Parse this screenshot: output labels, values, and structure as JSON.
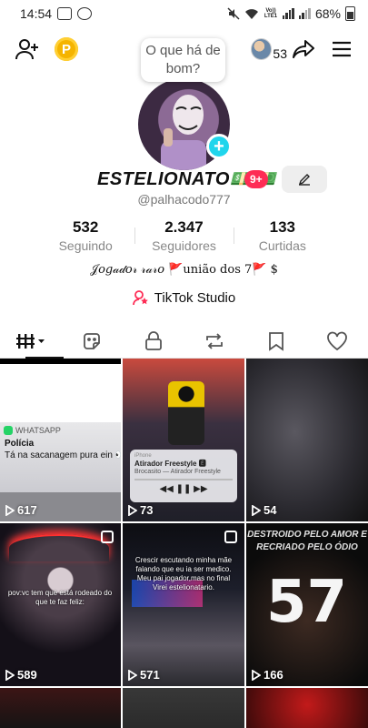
{
  "status_bar": {
    "time": "14:54",
    "volte": "Vo)) LTE1",
    "battery_text": "68%"
  },
  "top_nav": {
    "coin_letter": "P",
    "visitors_count": "53"
  },
  "profile": {
    "bubble_text": "O que há de bom?",
    "display_name": "ESTELIONATO💵💵",
    "badge_count": "9+",
    "username": "@palhacodo777",
    "stats": [
      {
        "value": "532",
        "label": "Seguindo"
      },
      {
        "value": "2.347",
        "label": "Seguidores"
      },
      {
        "value": "133",
        "label": "Curtidas"
      }
    ],
    "bio": "𝒥𝑜𝑔𝒶𝒹𝑜𝓇 𝓇𝒶𝓇𝑜 🚩união dos 7🚩 $",
    "studio_label": "TikTok Studio"
  },
  "tabs": [
    "videos-grid",
    "reposts",
    "private",
    "favorites-repost",
    "saved",
    "liked"
  ],
  "videos": [
    {
      "views": "617",
      "wa_app": "WHATSAPP",
      "wa_title": "Polícia",
      "wa_msg": "Tá na sacanagem pura ein 👀"
    },
    {
      "views": "73",
      "music_source": "iPhone",
      "music_title": "Atirador Freestyle 🅴",
      "music_artist": "Brocasito — Atirador Freestyle"
    },
    {
      "views": "54"
    },
    {
      "views": "589",
      "caption": "pov:vc tem que está rodeado do que te faz feliz:"
    },
    {
      "views": "571",
      "caption": "Crescir escutando minha mãe\nfalando que eu ia ser medico.\nMeu pai jogador,mas no final\nVirei estelionatario."
    },
    {
      "views": "166",
      "caption": "DESTROIDO PELO AMOR E RECRIADO PELO ÓDIO",
      "number": "57"
    },
    {},
    {},
    {}
  ],
  "colors": {
    "accent_pink": "#fe2c55",
    "accent_cyan": "#20d5ec",
    "coin_yellow": "#f5b400"
  }
}
